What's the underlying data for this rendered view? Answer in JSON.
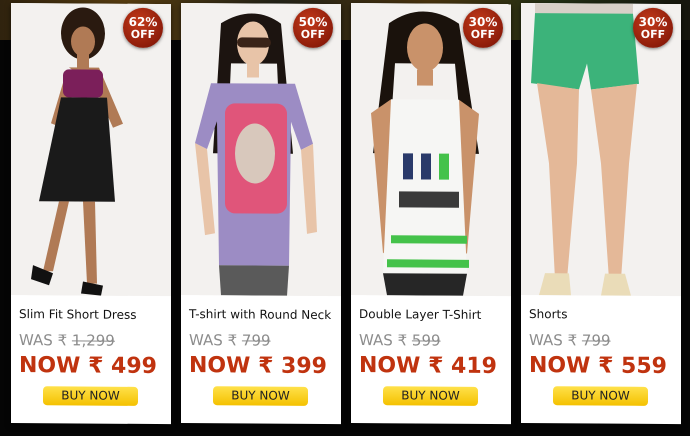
{
  "currency_symbol": "₹",
  "colors": {
    "badge": "#a3260f",
    "price_now": "#c0330f",
    "buy_button": "#f4c100",
    "background": "#050505"
  },
  "products": [
    {
      "name": "Slim Fit Short Dress",
      "discount_pct": "62%",
      "discount_label": "OFF",
      "was_label": "WAS",
      "was_price": "1,299",
      "now_label": "NOW",
      "now_price": "499",
      "buy_label": "BUY NOW"
    },
    {
      "name": "T-shirt with Round Neck",
      "discount_pct": "50%",
      "discount_label": "OFF",
      "was_label": "WAS",
      "was_price": "799",
      "now_label": "NOW",
      "now_price": "399",
      "buy_label": "BUY NOW"
    },
    {
      "name": "Double Layer T-Shirt",
      "discount_pct": "30%",
      "discount_label": "OFF",
      "was_label": "WAS",
      "was_price": "599",
      "now_label": "NOW",
      "now_price": "419",
      "buy_label": "BUY NOW"
    },
    {
      "name": "Shorts",
      "discount_pct": "30%",
      "discount_label": "OFF",
      "was_label": "WAS",
      "was_price": "799",
      "now_label": "NOW",
      "now_price": "559",
      "buy_label": "BUY NOW"
    }
  ]
}
